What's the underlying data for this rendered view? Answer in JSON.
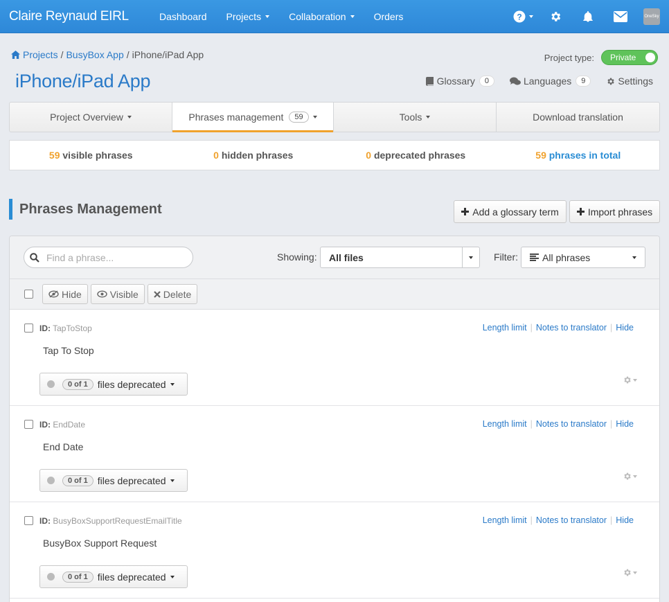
{
  "navbar": {
    "brand": "Claire Reynaud EIRL",
    "items": [
      {
        "label": "Dashboard"
      },
      {
        "label": "Projects"
      },
      {
        "label": "Collaboration"
      },
      {
        "label": "Orders"
      }
    ],
    "avatar_text": "OneSky"
  },
  "breadcrumb": {
    "items": [
      "Projects",
      "BusyBox App"
    ],
    "current": "iPhone/iPad App",
    "separator": "/"
  },
  "project_type": {
    "label": "Project type:",
    "value": "Private"
  },
  "page_title": "iPhone/iPad App",
  "header_links": {
    "glossary": {
      "label": "Glossary",
      "count": "0"
    },
    "languages": {
      "label": "Languages",
      "count": "9"
    },
    "settings": {
      "label": "Settings"
    }
  },
  "tabs": [
    {
      "label": "Project Overview"
    },
    {
      "label": "Phrases management",
      "count": "59"
    },
    {
      "label": "Tools"
    },
    {
      "label": "Download translation"
    }
  ],
  "stats": [
    {
      "num": "59",
      "label": "visible phrases"
    },
    {
      "num": "0",
      "label": "hidden phrases"
    },
    {
      "num": "0",
      "label": "deprecated phrases"
    },
    {
      "num": "59",
      "label": "phrases in total"
    }
  ],
  "section": {
    "title": "Phrases Management",
    "add_glossary": "Add a glossary term",
    "import": "Import phrases"
  },
  "filters": {
    "search_placeholder": "Find a phrase...",
    "showing_label": "Showing:",
    "showing_value": "All files",
    "filter_label": "Filter:",
    "filter_value": "All phrases"
  },
  "toolbar": {
    "hide": "Hide",
    "visible": "Visible",
    "delete": "Delete"
  },
  "phrase_actions": {
    "length_limit": "Length limit",
    "notes": "Notes to translator",
    "hide": "Hide",
    "separator": "|"
  },
  "phrases": [
    {
      "id_label": "ID:",
      "id": "TapToStop",
      "text": "Tap To Stop",
      "deprecated_count": "0 of 1",
      "deprecated_label": "files deprecated"
    },
    {
      "id_label": "ID:",
      "id": "EndDate",
      "text": "End Date",
      "deprecated_count": "0 of 1",
      "deprecated_label": "files deprecated"
    },
    {
      "id_label": "ID:",
      "id": "BusyBoxSupportRequestEmailTitle",
      "text": "BusyBox Support Request",
      "deprecated_count": "0 of 1",
      "deprecated_label": "files deprecated"
    }
  ],
  "colors": {
    "navbar": "#2e88d8",
    "accent_orange": "#f0a22e",
    "link_blue": "#2a7ac8",
    "toggle_green": "#5fc35a"
  }
}
